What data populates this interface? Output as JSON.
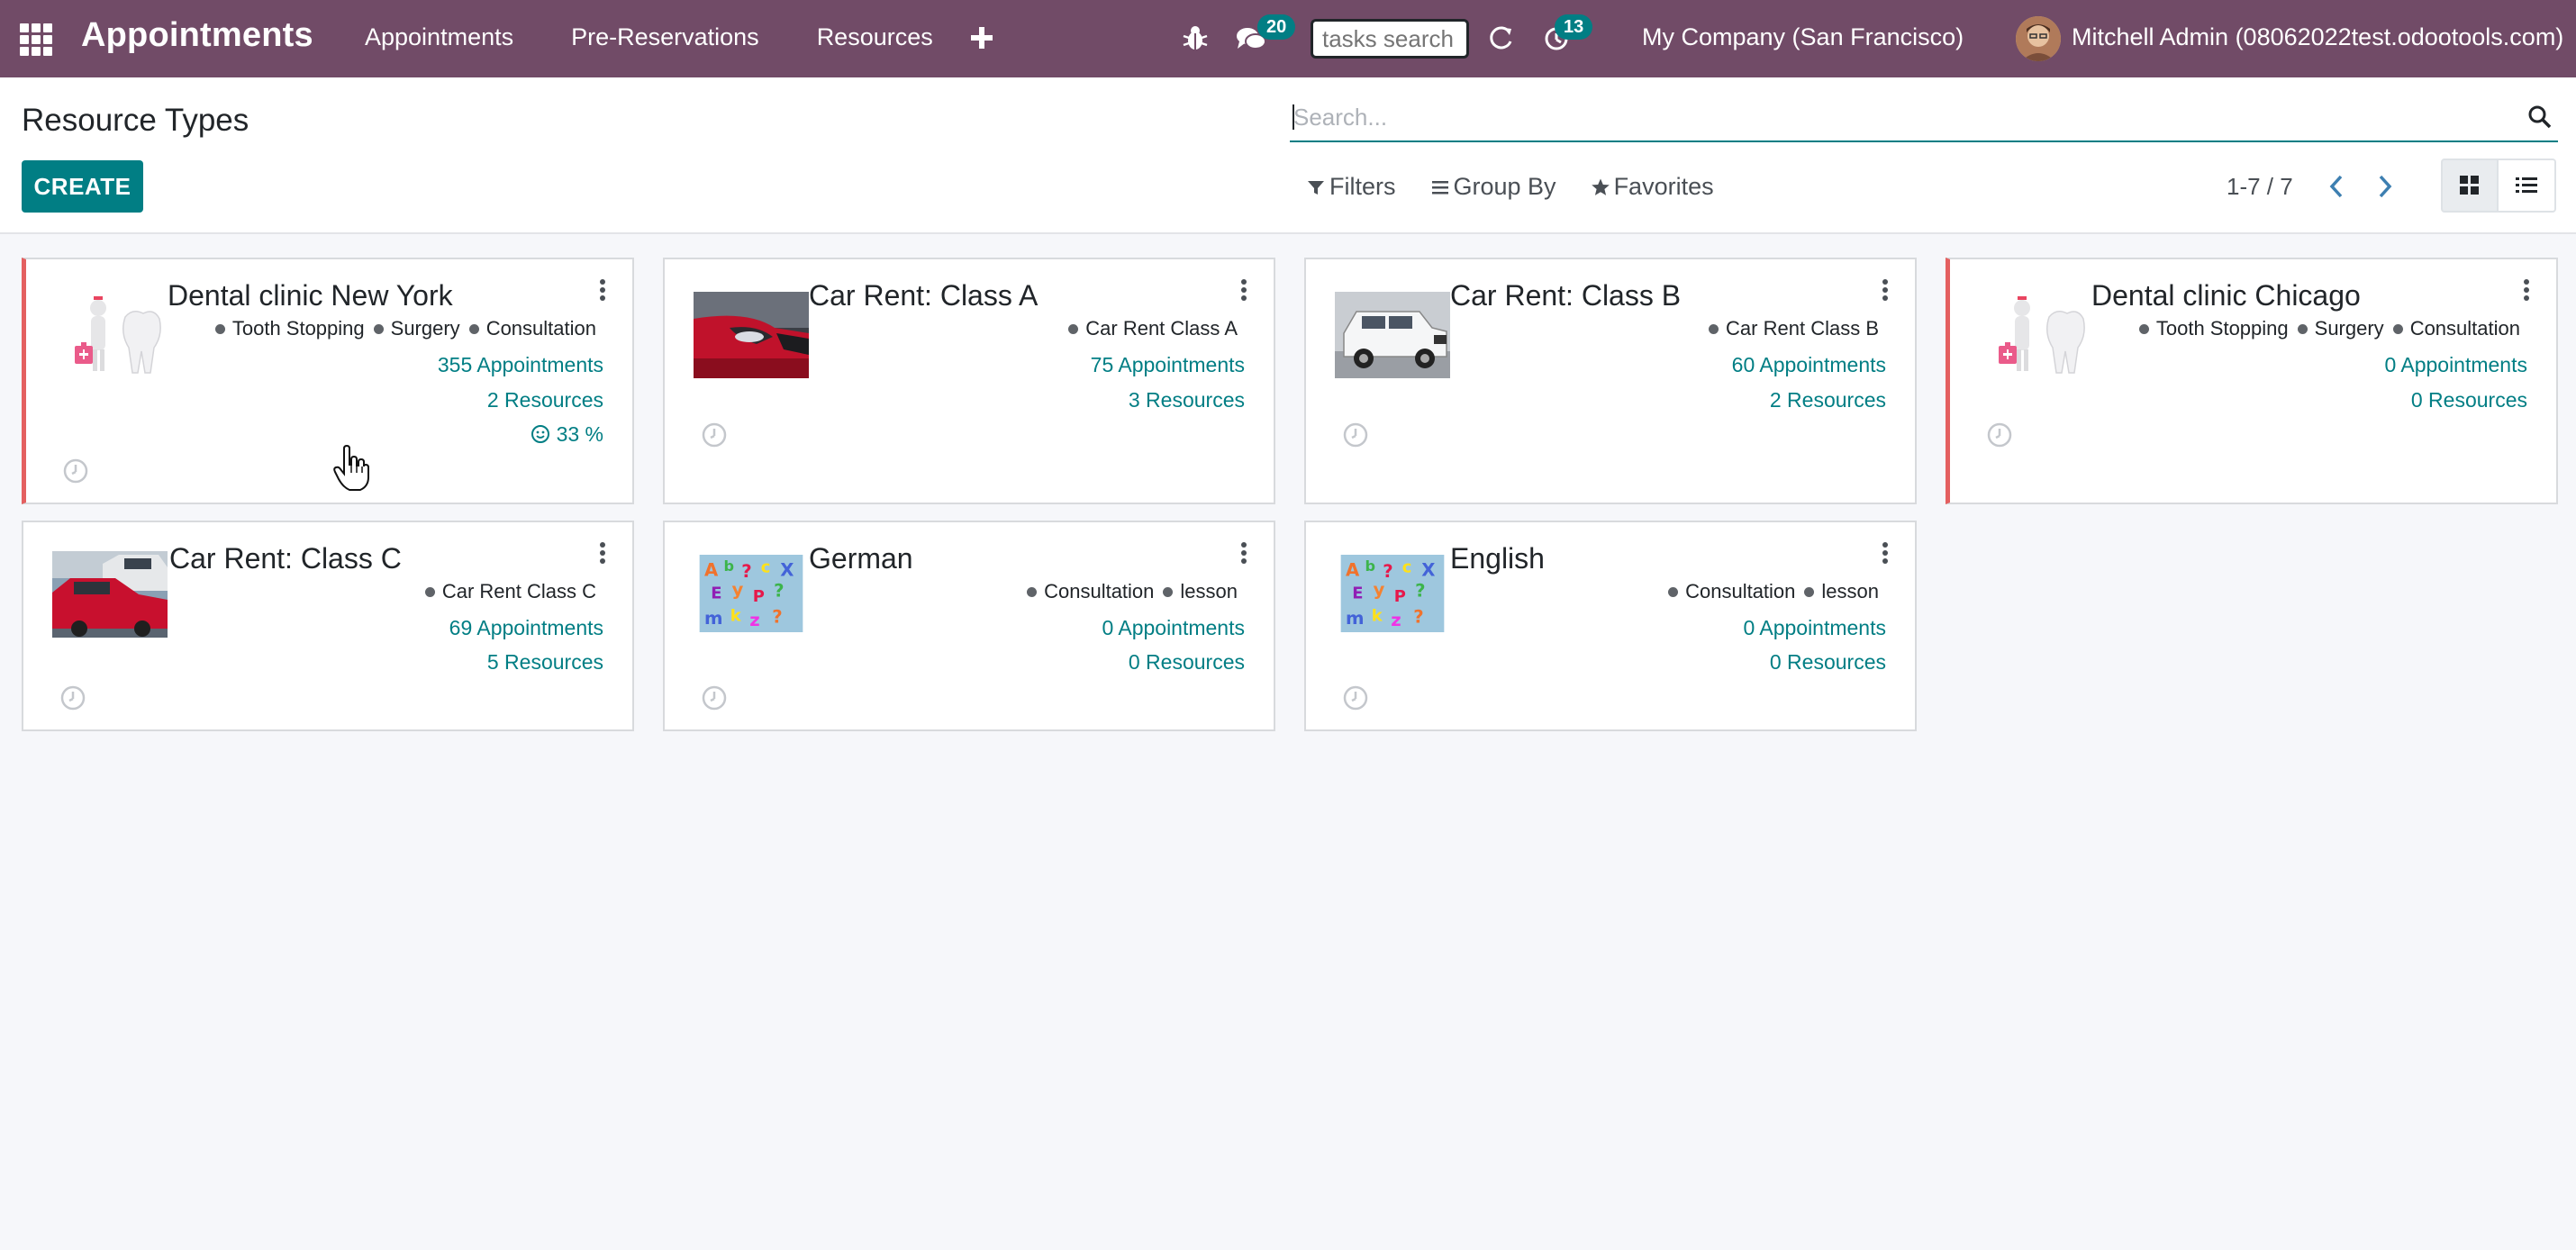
{
  "navbar": {
    "brand": "Appointments",
    "menu": [
      "Appointments",
      "Pre-Reservations",
      "Resources"
    ],
    "messages_count": "20",
    "tasks_search_placeholder": "tasks search",
    "activities_count": "13",
    "company": "My Company (San Francisco)",
    "user": "Mitchell Admin (08062022test.odootools.com)"
  },
  "control_panel": {
    "title": "Resource Types",
    "create_label": "CREATE",
    "search_placeholder": "Search...",
    "filters_label": "Filters",
    "group_by_label": "Group By",
    "favorites_label": "Favorites",
    "pager": "1-7 / 7"
  },
  "cards": [
    {
      "title": "Dental clinic New York",
      "tags": [
        "Tooth Stopping",
        "Surgery",
        "Consultation"
      ],
      "appointments": "355 Appointments",
      "resources": "2 Resources",
      "rating": "33 %",
      "image": "dentist"
    },
    {
      "title": "Car Rent: Class A",
      "tags": [
        "Car Rent Class A"
      ],
      "appointments": "75 Appointments",
      "resources": "3 Resources",
      "image": "red-car"
    },
    {
      "title": "Car Rent: Class B",
      "tags": [
        "Car Rent Class B"
      ],
      "appointments": "60 Appointments",
      "resources": "2 Resources",
      "image": "white-jeep"
    },
    {
      "title": "Dental clinic Chicago",
      "tags": [
        "Tooth Stopping",
        "Surgery",
        "Consultation"
      ],
      "appointments": "0 Appointments",
      "resources": "0 Resources",
      "image": "dentist"
    },
    {
      "title": "Car Rent: Class C",
      "tags": [
        "Car Rent Class C"
      ],
      "appointments": "69 Appointments",
      "resources": "5 Resources",
      "image": "parked-cars"
    },
    {
      "title": "German",
      "tags": [
        "Consultation",
        "lesson"
      ],
      "appointments": "0 Appointments",
      "resources": "0 Resources",
      "image": "letters"
    },
    {
      "title": "English",
      "tags": [
        "Consultation",
        "lesson"
      ],
      "appointments": "0 Appointments",
      "resources": "0 Resources",
      "image": "letters"
    }
  ],
  "colors": {
    "navbar": "#714b67",
    "accent": "#017e84",
    "danger_stripe": "#e46060"
  }
}
